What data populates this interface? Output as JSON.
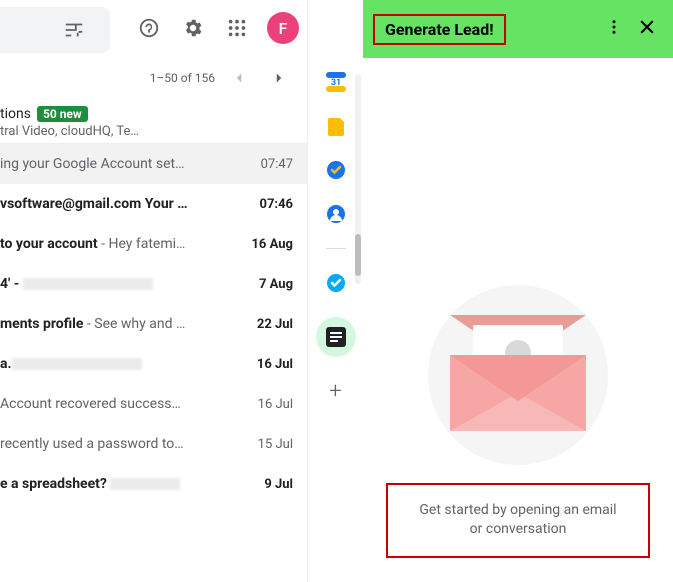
{
  "header": {
    "avatar_letter": "F"
  },
  "paginator": {
    "label": "1–50 of 156"
  },
  "category": {
    "title_suffix": "tions",
    "badge": "50 new",
    "sub": "tral Video, cloudHQ, Te…"
  },
  "rows": [
    {
      "subject": "ing your Google Account set…",
      "time": "07:47",
      "unread": false,
      "hover": true
    },
    {
      "subject": "vsoftware@gmail.com Your …",
      "time": "07:46",
      "unread": true
    },
    {
      "subject_prefix": "to your account",
      "preview": " - Hey fatemi…",
      "time": "16 Aug",
      "unread": true
    },
    {
      "subject": "4' - ",
      "time": "7 Aug",
      "unread": true,
      "redacted": true
    },
    {
      "subject_prefix": "ments profile",
      "preview": " - See why and …",
      "time": "22 Jul",
      "unread": true
    },
    {
      "subject": "a.",
      "time": "16 Jul",
      "unread": true,
      "redacted": true
    },
    {
      "subject": " Account recovered success…",
      "time": "16 Jul",
      "unread": false
    },
    {
      "subject": " recently used a password to…",
      "time": "15 Jul",
      "unread": false
    },
    {
      "subject": "e a spreadsheet? ",
      "time": "9 Jul",
      "unread": true,
      "redacted": true,
      "redact_small": true
    }
  ],
  "panel": {
    "title": "Generate Lead!",
    "get_started": "Get started by opening an email or conversation"
  }
}
